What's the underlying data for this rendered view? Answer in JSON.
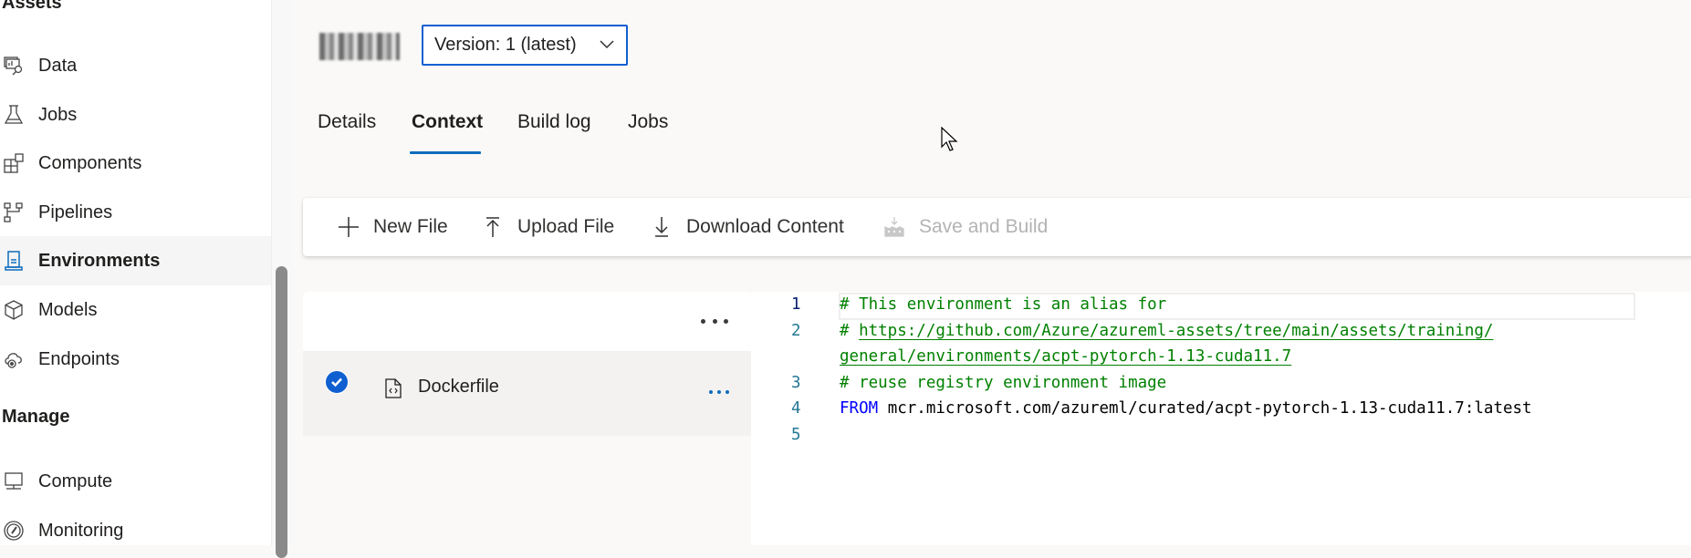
{
  "sidebar": {
    "assets_heading": "Assets",
    "manage_heading": "Manage",
    "items": [
      {
        "label": "Data",
        "icon": "data-icon"
      },
      {
        "label": "Jobs",
        "icon": "flask-icon"
      },
      {
        "label": "Components",
        "icon": "components-icon"
      },
      {
        "label": "Pipelines",
        "icon": "pipelines-icon"
      },
      {
        "label": "Environments",
        "icon": "environment-icon",
        "active": true
      },
      {
        "label": "Models",
        "icon": "cube-icon"
      },
      {
        "label": "Endpoints",
        "icon": "cloud-endpoint-icon"
      }
    ],
    "manage_items": [
      {
        "label": "Compute",
        "icon": "monitor-icon"
      },
      {
        "label": "Monitoring",
        "icon": "gauge-icon"
      }
    ]
  },
  "header": {
    "title": "sri45",
    "version_dropdown": "Version: 1 (latest)"
  },
  "tabs": [
    {
      "label": "Details"
    },
    {
      "label": "Context",
      "active": true
    },
    {
      "label": "Build log"
    },
    {
      "label": "Jobs"
    }
  ],
  "toolbar": {
    "new_file": "New File",
    "upload_file": "Upload File",
    "download_content": "Download Content",
    "save_and_build": "Save and Build"
  },
  "files": [
    {
      "name": "Dockerfile",
      "selected": true
    }
  ],
  "editor": {
    "line_numbers": [
      "1",
      "2",
      "",
      "3",
      "4",
      "5"
    ],
    "lines": {
      "l1": "# This environment is an alias for",
      "l2_hash": "# ",
      "l2_link": "https://github.com/Azure/azureml-assets/tree/main/assets/training/",
      "l2_wrap": "general/environments/acpt-pytorch-1.13-cuda11.7",
      "l3": "# reuse registry environment image",
      "l4_kw": "FROM",
      "l4_rest": " mcr.microsoft.com/azureml/curated/acpt-pytorch-1.13-cuda11.7:latest",
      "l5": ""
    }
  },
  "colors": {
    "accent": "#0f6cbd",
    "comment": "#008000",
    "keyword": "#0000ff",
    "line_number": "#237893"
  }
}
